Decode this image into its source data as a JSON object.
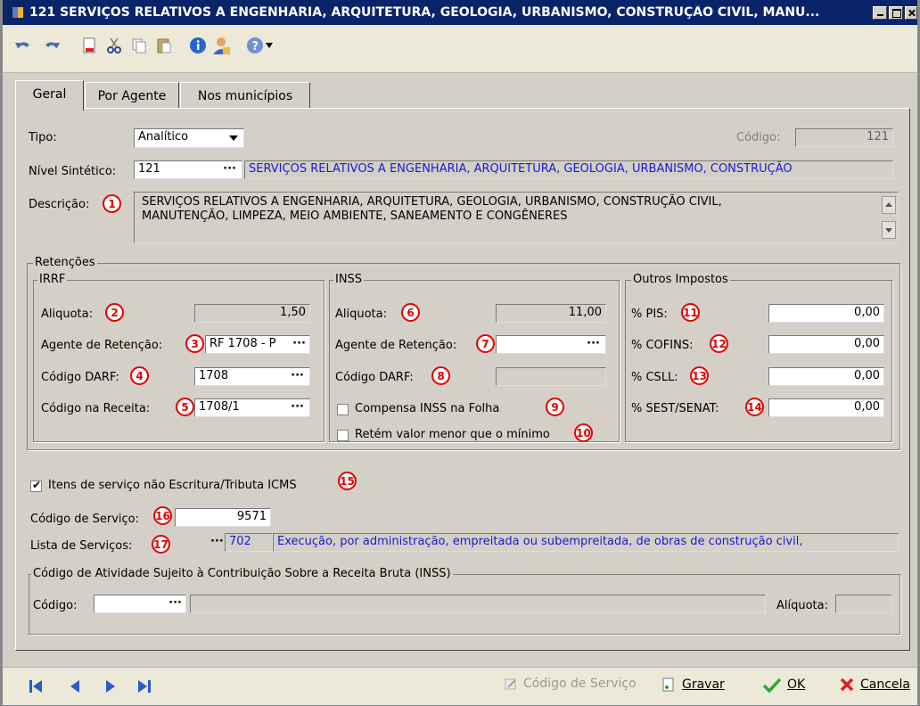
{
  "window": {
    "title": "121 SERVIÇOS RELATIVOS A ENGENHARIA, ARQUITETURA, GEOLOGIA, URBANISMO, CONSTRUÇÃO CIVIL, MANU..."
  },
  "tabs": [
    {
      "label": "Geral"
    },
    {
      "label": "Por Agente"
    },
    {
      "label": "Nos municípios"
    }
  ],
  "form": {
    "tipo_label": "Tipo:",
    "tipo_value": "Analítico",
    "codigo_label": "Código:",
    "codigo_value": "121",
    "nivel_label": "Nível Sintético:",
    "nivel_code": "121",
    "nivel_desc": "SERVIÇOS RELATIVOS A ENGENHARIA, ARQUITETURA, GEOLOGIA, URBANISMO, CONSTRUÇÃO",
    "descricao_label": "Descrição:",
    "descricao_line1": "SERVIÇOS RELATIVOS A ENGENHARIA, ARQUITETURA, GEOLOGIA, URBANISMO, CONSTRUÇÃO CIVIL,",
    "descricao_line2": "MANUTENÇÃO, LIMPEZA, MEIO AMBIENTE, SANEAMENTO E CONGÊNERES"
  },
  "retencoes": {
    "title": "Retenções",
    "irrf": {
      "title": "IRRF",
      "aliquota_label": "Aliquota:",
      "aliquota_value": "1,50",
      "agente_label": "Agente de Retenção:",
      "agente_value": "RF 1708 - P",
      "darf_label": "Código DARF:",
      "darf_value": "1708",
      "receita_label": "Código na Receita:",
      "receita_value": "1708/1"
    },
    "inss": {
      "title": "INSS",
      "aliquota_label": "Aliquota:",
      "aliquota_value": "11,00",
      "agente_label": "Agente de Retenção:",
      "agente_value": "",
      "darf_label": "Código DARF:",
      "darf_value": "",
      "compensa_label": "Compensa INSS na Folha",
      "retem_label": "Retém valor menor que o mínimo"
    },
    "outros": {
      "title": "Outros Impostos",
      "pis_label": "% PIS:",
      "pis_value": "0,00",
      "cofins_label": "% COFINS:",
      "cofins_value": "0,00",
      "csll_label": "% CSLL:",
      "csll_value": "0,00",
      "sest_label": "% SEST/SENAT:",
      "sest_value": "0,00"
    }
  },
  "icms": {
    "label": "Itens de serviço não Escritura/Tributa ICMS",
    "checked": true
  },
  "servico": {
    "codigo_label": "Código de Serviço:",
    "codigo_value": "9571",
    "lista_label": "Lista de Serviços:",
    "lista_code": "702",
    "lista_desc": "Execução, por administração, empreitada ou subempreitada, de obras de construção civil,"
  },
  "atividade": {
    "title": "Código de Atividade Sujeito à Contribuição Sobre a Receita Bruta (INSS)",
    "codigo_label": "Código:",
    "codigo_value": "",
    "aliquota_label": "Alíquota:",
    "aliquota_value": ""
  },
  "badges": [
    "1",
    "2",
    "3",
    "4",
    "5",
    "6",
    "7",
    "8",
    "9",
    "10",
    "11",
    "12",
    "13",
    "14",
    "15",
    "16",
    "17"
  ],
  "bottom": {
    "codigo_servico": "Código de Serviço",
    "gravar": "Gravar",
    "ok": "OK",
    "cancela": "Cancela"
  },
  "colors": {
    "badge": "#e00000",
    "title_bar": "#0a246a",
    "link_text": "#1a1acc"
  }
}
